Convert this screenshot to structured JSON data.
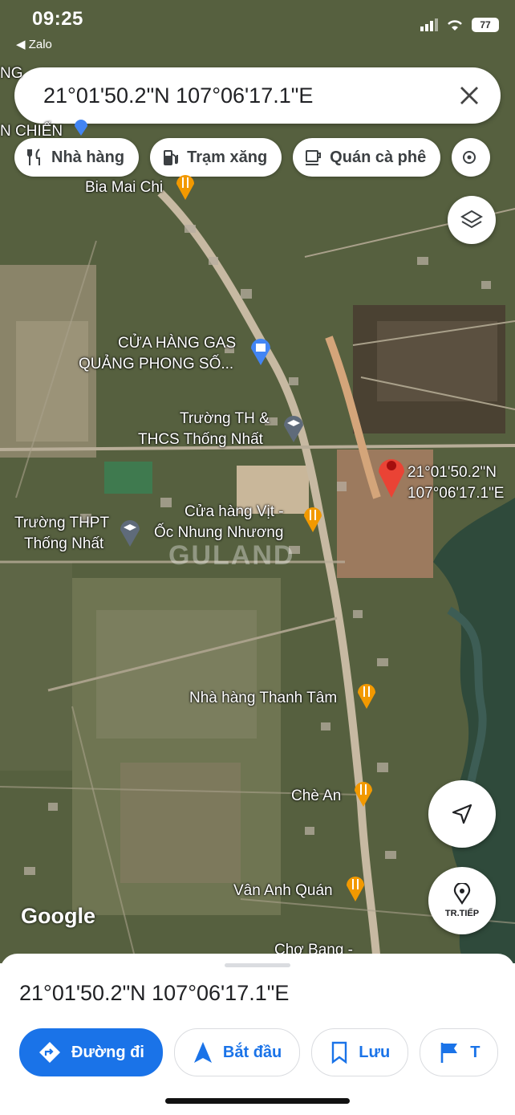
{
  "status_bar": {
    "time": "09:25",
    "back_app": "◀ Zalo",
    "battery": "77"
  },
  "search": {
    "query": "21°01'50.2\"N 107°06'17.1\"E"
  },
  "chips": [
    {
      "label": "Nhà hàng",
      "icon": "fork-knife-icon"
    },
    {
      "label": "Trạm xăng",
      "icon": "gas-station-icon"
    },
    {
      "label": "Quán cà phê",
      "icon": "coffee-cup-icon"
    }
  ],
  "map": {
    "labels": {
      "bia_mai_chi": "Bia Mai Chi",
      "gas_1": "CỬA HÀNG GAS",
      "gas_2": "QUẢNG PHONG SỐ...",
      "school1_1": "Trường TH &",
      "school1_2": "THCS Thống Nhất",
      "pin_1": "21°01'50.2\"N",
      "pin_2": "107°06'17.1\"E",
      "vit_1": "Cửa hàng Vịt -",
      "vit_2": "Ốc Nhung Nhương",
      "school2_1": "Trường THPT",
      "school2_2": "Thống Nhất",
      "thanh_tam": "Nhà hàng Thanh Tâm",
      "che_an": "Chè An",
      "van_anh": "Vân Anh Quán",
      "cho_bang": "Chợ Bang -",
      "edge_1": "NG",
      "edge_2": "N CHIẾN"
    },
    "google_logo": "Google",
    "watermark": "GULAND",
    "recenter_label": "TR.TIẾP"
  },
  "sheet": {
    "title": "21°01'50.2\"N 107°06'17.1\"E",
    "actions": [
      {
        "label": "Đường đi"
      },
      {
        "label": "Bắt đầu"
      },
      {
        "label": "Lưu"
      },
      {
        "label": "T"
      }
    ]
  },
  "colors": {
    "accent": "#1a73e8",
    "pin": "#ea4335",
    "poi_orange": "#f29900"
  }
}
